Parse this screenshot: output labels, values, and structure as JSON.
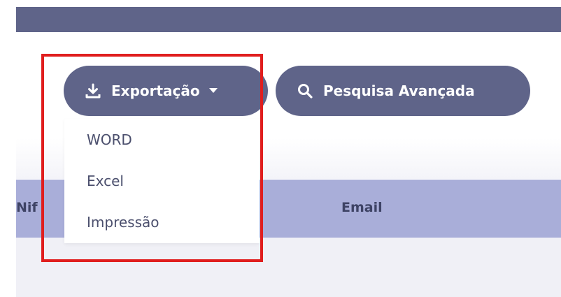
{
  "header": {
    "bar_color": "#5f6489"
  },
  "toolbar": {
    "export_label": "Exportação",
    "export_icon": "download-icon",
    "export_caret": "caret-down-icon",
    "search_label": "Pesquisa Avançada",
    "search_icon": "search-icon",
    "button_color": "#5f6489"
  },
  "export_menu": {
    "items": [
      {
        "label": "WORD"
      },
      {
        "label": "Excel"
      },
      {
        "label": "Impressão"
      }
    ]
  },
  "table": {
    "columns": [
      "Nif",
      "Email"
    ],
    "header_color": "#a9aed9"
  },
  "annotation": {
    "highlight_color": "#e01e1e"
  }
}
